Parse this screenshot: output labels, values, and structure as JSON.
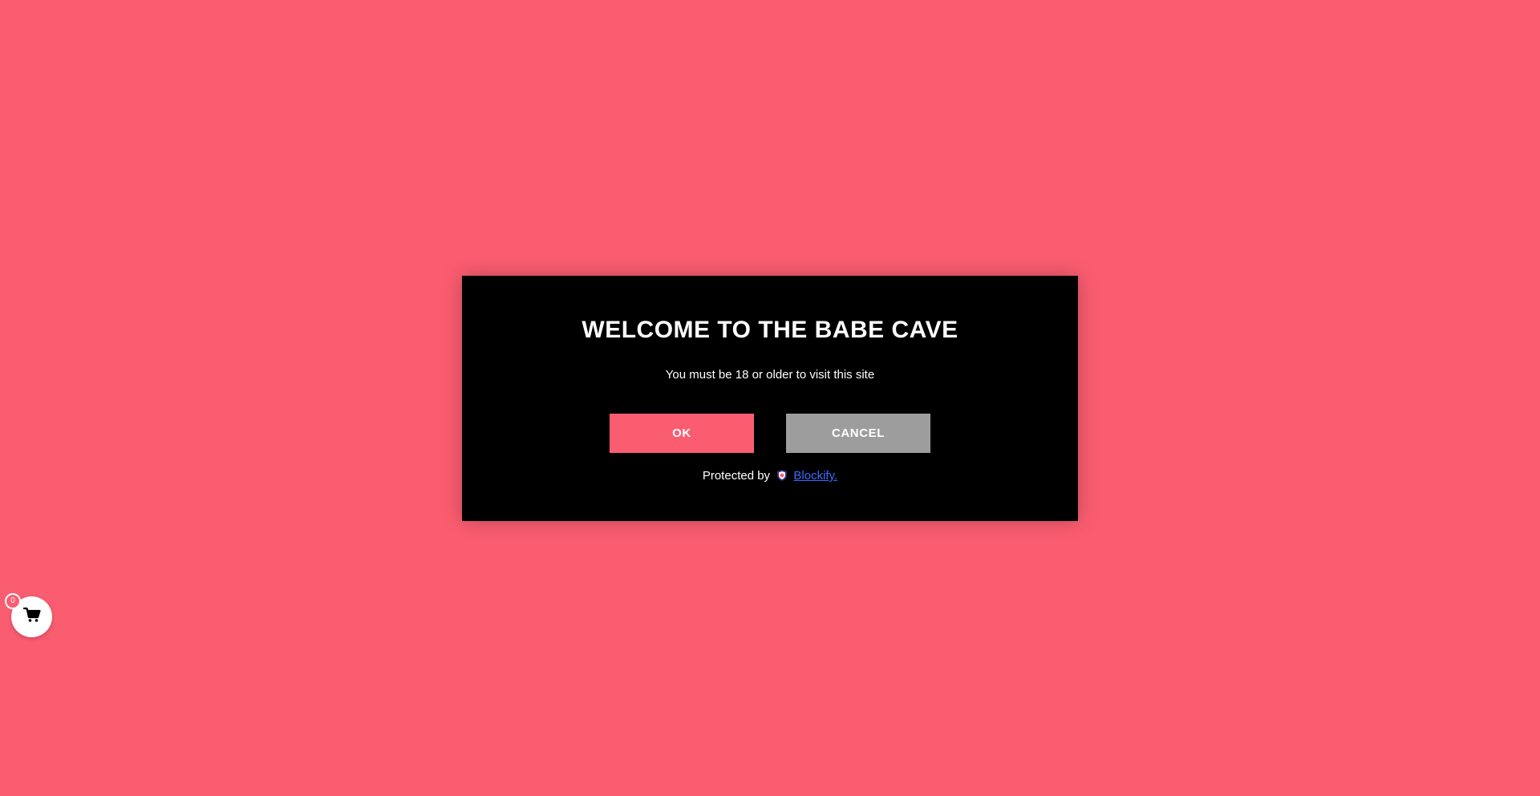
{
  "colors": {
    "background": "#fb5d70",
    "modal_background": "#000000",
    "ok_button": "#fb5d70",
    "cancel_button": "#9d9d9d",
    "link": "#3b6bff"
  },
  "age_gate": {
    "title": "WELCOME TO THE BABE CAVE",
    "subtitle": "You must be 18 or older to visit this site",
    "ok_label": "OK",
    "cancel_label": "CANCEL",
    "protected_by": "Protected by",
    "protected_icon": "blockify-shield-icon",
    "brand_link": "Blockify."
  },
  "cart": {
    "icon": "cart-icon",
    "count": "0"
  }
}
